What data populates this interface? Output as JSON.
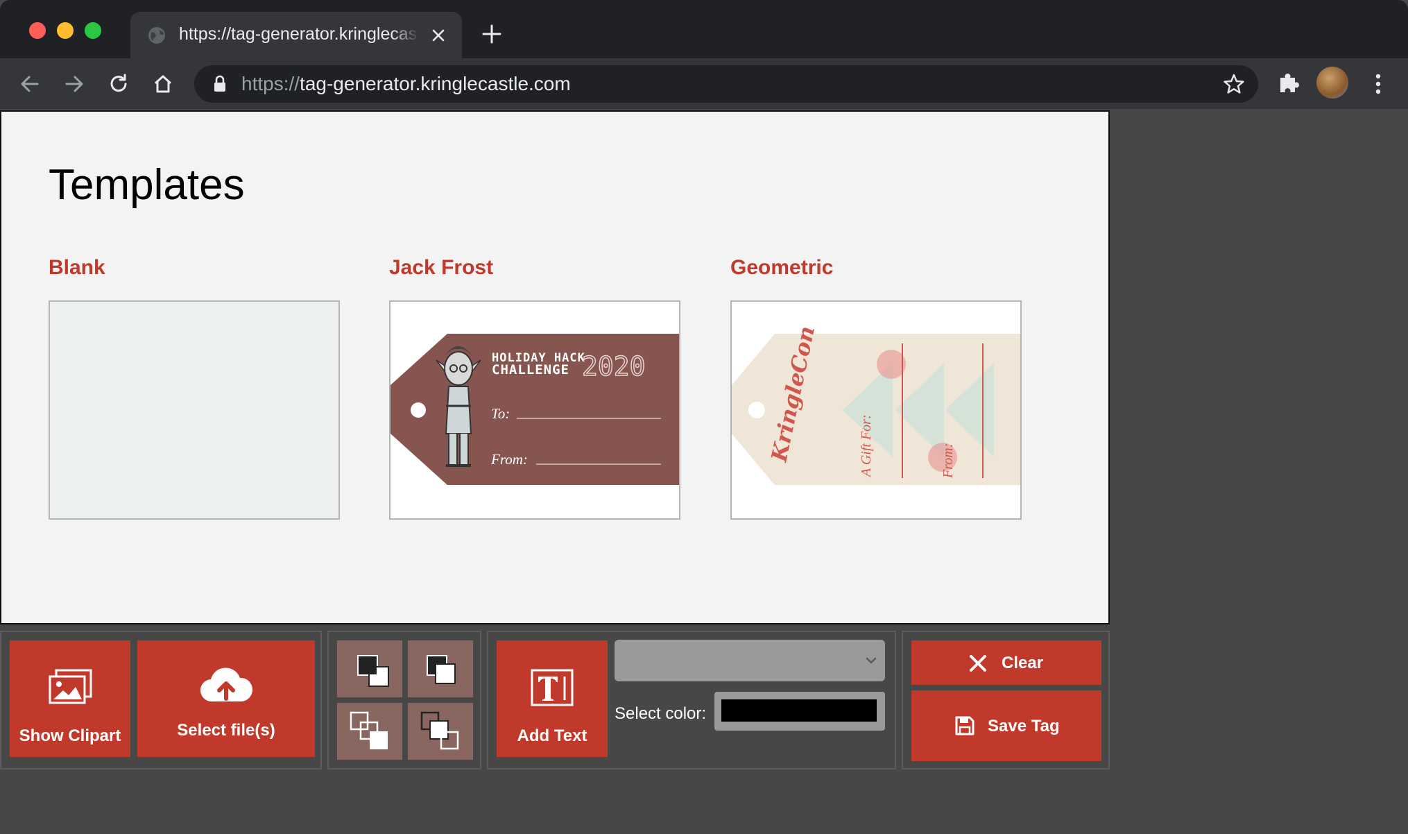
{
  "browser": {
    "tab": {
      "title": "https://tag-generator.kringlecastle.com"
    },
    "address_bar": {
      "scheme": "https://",
      "host": "tag-generator.kringlecastle.com"
    }
  },
  "page": {
    "heading": "Templates",
    "templates": [
      {
        "name": "Blank"
      },
      {
        "name": "Jack Frost",
        "tag": {
          "line1": "HOLIDAY HACK",
          "line2": "CHALLENGE",
          "year": "2020",
          "to_label": "To:",
          "from_label": "From:"
        }
      },
      {
        "name": "Geometric",
        "tag": {
          "brand": "KringleCon",
          "gift_label": "A Gift For:",
          "from_label": "From:"
        }
      }
    ]
  },
  "toolbar": {
    "show_clipart_label": "Show Clipart",
    "select_files_label": "Select file(s)",
    "add_text_label": "Add Text",
    "select_color_label": "Select color:",
    "selected_color": "#000000",
    "clear_label": "Clear",
    "save_tag_label": "Save Tag"
  },
  "colors": {
    "accent": "#c0392b",
    "tag_maroon": "#86554f",
    "tag_cream": "#efe6d7"
  }
}
